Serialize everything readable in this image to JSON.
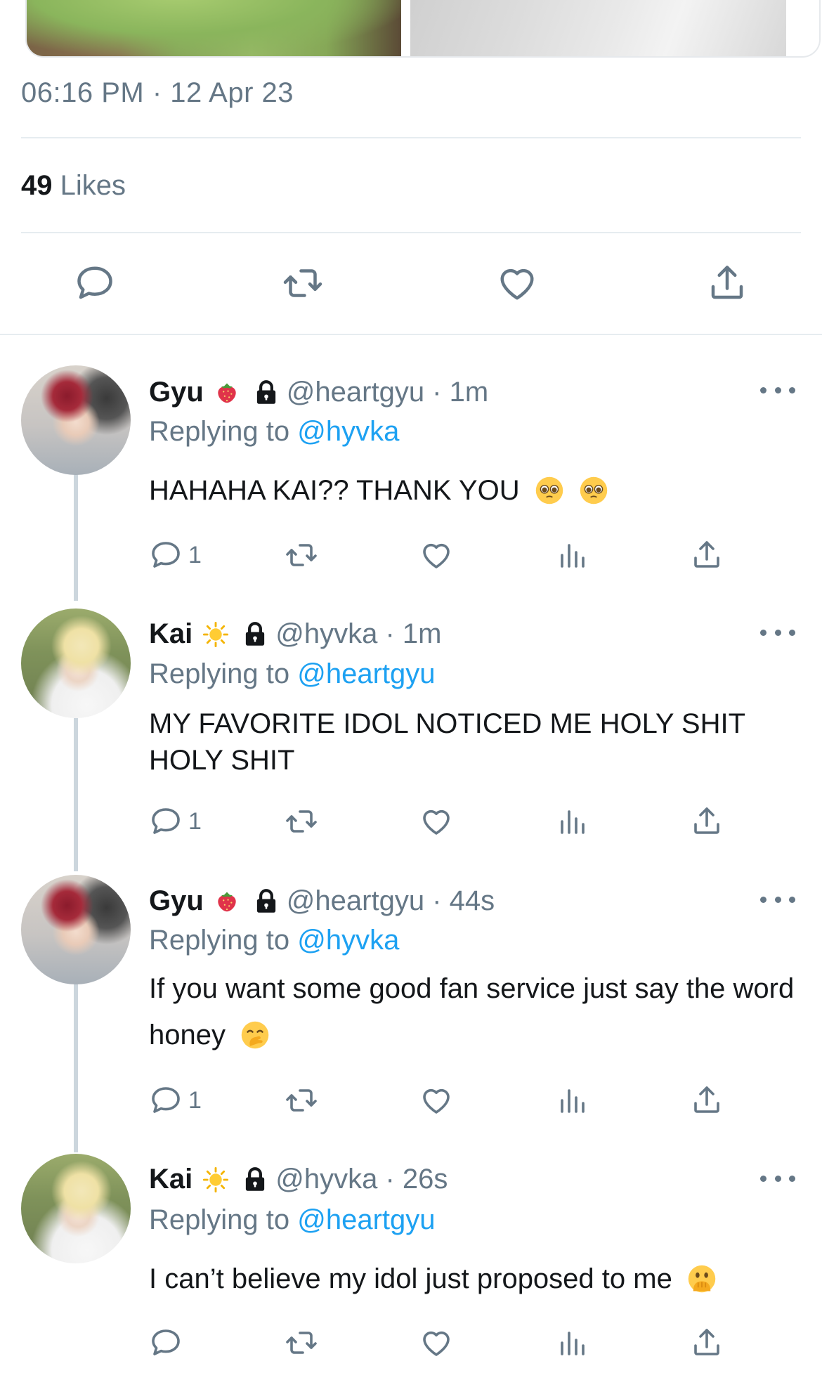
{
  "tweet": {
    "timestamp": "06:16 PM · 12 Apr 23",
    "likes_count": "49",
    "likes_label": "Likes"
  },
  "icons": {
    "reply": "speech-bubble-icon",
    "retweet": "retweet-icon",
    "like": "heart-icon",
    "share": "share-upload-icon",
    "views": "bar-chart-icon",
    "more": "more-horizontal-icon",
    "protected": "lock-icon"
  },
  "colors": {
    "link": "#1da1f2",
    "muted": "#657786",
    "text": "#14171a",
    "divider": "#e6ecf0"
  },
  "replies": [
    {
      "name": "Gyu",
      "name_emoji": "strawberry",
      "handle": "@heartgyu · 1m",
      "replying_label": "Replying to",
      "replying_to": "@hyvka",
      "text": "HAHAHA KAI?? THANK YOU",
      "text_emoji": "pleading-face ×2",
      "reply_count": "1"
    },
    {
      "name": "Kai",
      "name_emoji": "sun",
      "handle": "@hyvka · 1m",
      "replying_label": "Replying to",
      "replying_to": "@heartgyu",
      "text": "MY FAVORITE IDOL NOTICED ME HOLY SHIT HOLY SHIT",
      "reply_count": "1"
    },
    {
      "name": "Gyu",
      "name_emoji": "strawberry",
      "handle": "@heartgyu · 44s",
      "replying_label": "Replying to",
      "replying_to": "@hyvka",
      "text": "If you want some good fan service just say the word honey",
      "text_emoji": "hand-over-mouth",
      "reply_count": "1"
    },
    {
      "name": "Kai",
      "name_emoji": "sun",
      "handle": "@hyvka · 26s",
      "replying_label": "Replying to",
      "replying_to": "@heartgyu",
      "text": "I can’t believe my idol just proposed to me",
      "text_emoji": "face-with-open-eyes-and-hand-over-mouth",
      "reply_count": ""
    }
  ]
}
